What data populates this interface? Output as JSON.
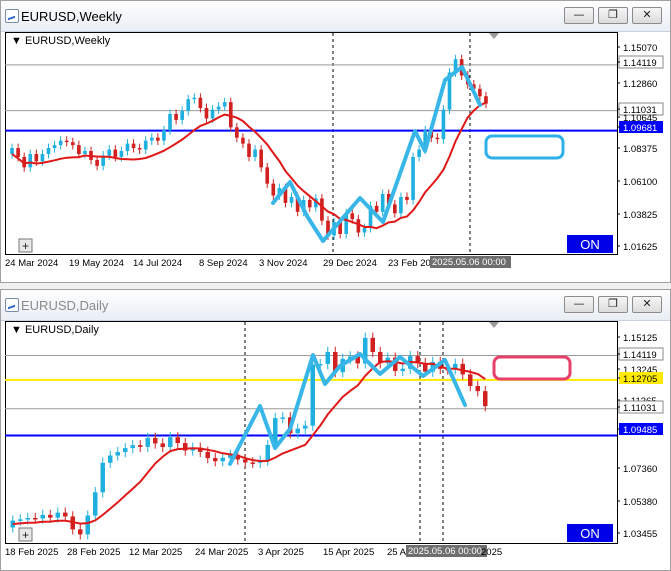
{
  "colors": {
    "bull": "#20b0e0",
    "bear": "#d02020",
    "ma": "#e01818",
    "zigzag": "#38b6e8",
    "blue_line": "#0000ff",
    "yellow_line": "#ffea00",
    "on_bg": "#0000e8",
    "box1": "#30b0e8",
    "box2": "#e8406a"
  },
  "windows": [
    {
      "title": "EURUSD,Weekly",
      "chart_label": "EURUSD,Weekly",
      "buttons": {
        "minimize": "—",
        "restore": "❐",
        "close": "✕"
      },
      "on_label": "ON",
      "x_labels": [
        "24 Mar 2024",
        "19 May 2024",
        "14 Jul 2024",
        "8 Sep 2024",
        "3 Nov 2024",
        "29 Dec 2024",
        "23 Feb 20",
        "2025.05.06 00:00"
      ],
      "y_labels": [
        "1.15070",
        "1.14119",
        "1.12860",
        "1.11031",
        "1.10645",
        "1.09681",
        "1.08375",
        "1.06100",
        "1.03825",
        "1.01625"
      ]
    },
    {
      "title": "EURUSD,Daily",
      "chart_label": "EURUSD,Daily",
      "buttons": {
        "minimize": "—",
        "restore": "❐",
        "close": "✕"
      },
      "on_label": "ON",
      "x_labels": [
        "18 Feb 2025",
        "28 Feb 2025",
        "12 Mar 2025",
        "24 Mar 2025",
        "3 Apr 2025",
        "15 Apr 2025",
        "25 A",
        "2025.05.06 00:00",
        "2025"
      ],
      "y_labels": [
        "1.15125",
        "1.14119",
        "1.13245",
        "1.12705",
        "1.11365",
        "1.11031",
        "1.09485",
        "1.07360",
        "1.05380",
        "1.03455"
      ]
    }
  ],
  "chart_data": [
    {
      "type": "candlestick",
      "title": "EURUSD,Weekly",
      "ylim": [
        1.0135,
        1.162
      ],
      "grid": false,
      "current_price": "1.11031",
      "hlines": {
        "blue": 1.0968,
        "gray": [
          1.14119,
          1.11031
        ]
      },
      "candles_close": [
        1.085,
        1.079,
        1.072,
        1.081,
        1.076,
        1.081,
        1.085,
        1.087,
        1.09,
        1.089,
        1.087,
        1.081,
        1.083,
        1.077,
        1.073,
        1.08,
        1.084,
        1.079,
        1.083,
        1.088,
        1.085,
        1.084,
        1.09,
        1.092,
        1.09,
        1.097,
        1.108,
        1.104,
        1.11,
        1.118,
        1.119,
        1.112,
        1.105,
        1.111,
        1.113,
        1.116,
        1.099,
        1.092,
        1.088,
        1.079,
        1.084,
        1.072,
        1.061,
        1.053,
        1.058,
        1.048,
        1.052,
        1.042,
        1.05,
        1.045,
        1.051,
        1.036,
        1.026,
        1.035,
        1.027,
        1.041,
        1.037,
        1.028,
        1.031,
        1.046,
        1.042,
        1.054,
        1.047,
        1.041,
        1.052,
        1.05,
        1.079,
        1.084,
        1.097,
        1.092,
        1.091,
        1.111,
        1.136,
        1.145,
        1.134,
        1.128,
        1.125,
        1.12,
        1.115
      ]
    },
    {
      "type": "candlestick",
      "title": "EURUSD,Daily",
      "ylim": [
        1.0325,
        1.16
      ],
      "grid": false,
      "current_price": "1.11031",
      "hlines": {
        "blue": 1.0948,
        "yellow": 1.12705,
        "gray": [
          1.14119,
          1.11031
        ]
      },
      "candles_close": [
        1.0455,
        1.0462,
        1.047,
        1.0467,
        1.0488,
        1.0472,
        1.0501,
        1.0479,
        1.0404,
        1.0375,
        1.0484,
        1.0619,
        1.079,
        1.0832,
        1.0852,
        1.0875,
        1.0892,
        1.0882,
        1.0934,
        1.0902,
        1.0881,
        1.0938,
        1.0904,
        1.0861,
        1.0877,
        1.0853,
        1.0817,
        1.0799,
        1.0819,
        1.0836,
        1.0809,
        1.0792,
        1.079,
        1.0802,
        1.0893,
        1.1049,
        1.1053,
        1.0961,
        1.0988,
        1.1005,
        1.1359,
        1.1362,
        1.1432,
        1.1315,
        1.1392,
        1.1406,
        1.1366,
        1.1514,
        1.1432,
        1.1367,
        1.1399,
        1.1322,
        1.1335,
        1.1408,
        1.1368,
        1.1318,
        1.1374,
        1.1334,
        1.1331,
        1.1363,
        1.1302,
        1.1235,
        1.1205,
        1.1118
      ]
    }
  ]
}
